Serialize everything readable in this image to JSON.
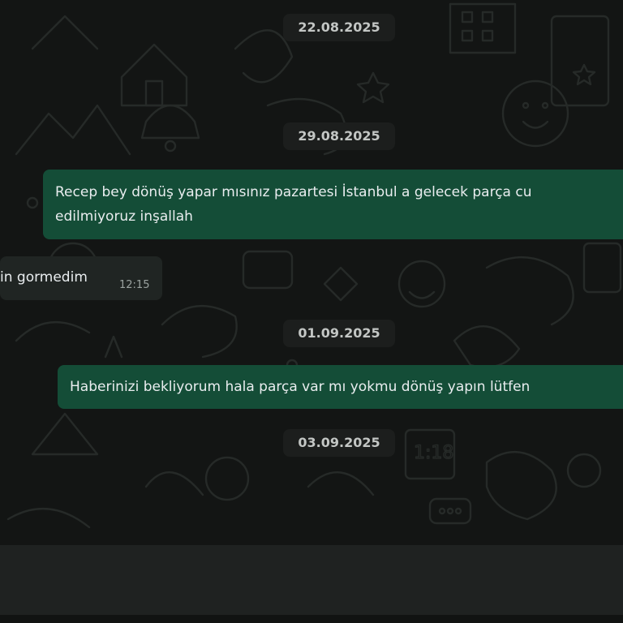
{
  "chat": {
    "dates": [
      "22.08.2025",
      "29.08.2025",
      "01.09.2025",
      "03.09.2025"
    ],
    "messages": [
      {
        "direction": "outgoing",
        "lines": [
          "Recep bey dönüş yapar mısınız pazartesi İstanbul a gelecek parça cu",
          "edilmiyoruz inşallah"
        ]
      },
      {
        "direction": "incoming",
        "text": "in gormedim",
        "time": "12:15"
      },
      {
        "direction": "outgoing",
        "text": "Haberinizi bekliyorum hala parça var mı yokmu dönüş yapın lütfen"
      }
    ]
  },
  "colors": {
    "background": "#131514",
    "outgoing_bubble": "#144d37",
    "incoming_bubble": "#202523",
    "date_chip": "#1c1e1d",
    "composer": "#1f2221"
  }
}
